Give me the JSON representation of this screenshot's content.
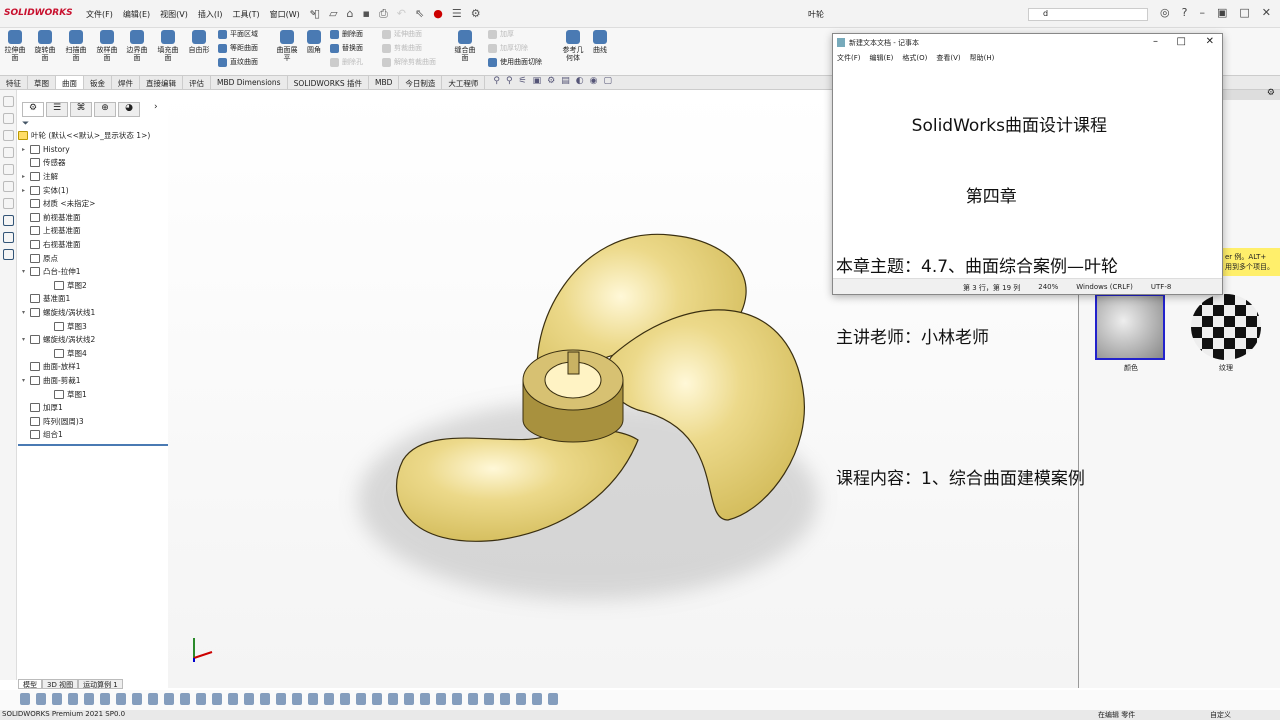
{
  "titlebar": {
    "brand": "SOLIDWORKS",
    "menus": [
      "文件(F)",
      "编辑(E)",
      "视图(V)",
      "插入(I)",
      "工具(T)",
      "窗口(W)"
    ],
    "document": "叶轮",
    "search_value": "d"
  },
  "ribbon": {
    "big": [
      "拉伸曲面",
      "旋转曲面",
      "扫描曲面",
      "放样曲面",
      "边界曲面",
      "填充曲面",
      "自由形"
    ],
    "col1": [
      "平面区域",
      "等距曲面",
      "直纹曲面"
    ],
    "flatten": "曲面展平",
    "fillet": "圆角",
    "col2": [
      "删除面",
      "替换面",
      "删除孔"
    ],
    "col3": [
      "延伸曲面",
      "剪裁曲面",
      "解除剪裁曲面"
    ],
    "knit": "缝合曲面",
    "col4": [
      "加厚",
      "加厚切除",
      "使用曲面切除"
    ],
    "refgeo": "参考几何体",
    "curves": "曲线"
  },
  "tabs": [
    "特征",
    "草图",
    "曲面",
    "钣金",
    "焊件",
    "直接编辑",
    "评估",
    "MBD Dimensions",
    "SOLIDWORKS 插件",
    "MBD",
    "今日制造",
    "大工程师"
  ],
  "tree": {
    "root": "叶轮 (默认<<默认>_显示状态 1>)",
    "items": [
      {
        "label": "History",
        "ex": "▸",
        "ind": 0
      },
      {
        "label": "传感器",
        "ex": "",
        "ind": 0
      },
      {
        "label": "注解",
        "ex": "▸",
        "ind": 0
      },
      {
        "label": "实体(1)",
        "ex": "▸",
        "ind": 0
      },
      {
        "label": "材质 <未指定>",
        "ex": "",
        "ind": 0
      },
      {
        "label": "前视基准面",
        "ex": "",
        "ind": 0
      },
      {
        "label": "上视基准面",
        "ex": "",
        "ind": 0
      },
      {
        "label": "右视基准面",
        "ex": "",
        "ind": 0
      },
      {
        "label": "原点",
        "ex": "",
        "ind": 0
      },
      {
        "label": "凸台-拉伸1",
        "ex": "▾",
        "ind": 0
      },
      {
        "label": "草图2",
        "ex": "",
        "ind": 1
      },
      {
        "label": "基准面1",
        "ex": "",
        "ind": 0
      },
      {
        "label": "螺旋线/涡状线1",
        "ex": "▾",
        "ind": 0
      },
      {
        "label": "草图3",
        "ex": "",
        "ind": 1
      },
      {
        "label": "螺旋线/涡状线2",
        "ex": "▾",
        "ind": 0
      },
      {
        "label": "草图4",
        "ex": "",
        "ind": 1
      },
      {
        "label": "曲面-放样1",
        "ex": "",
        "ind": 0
      },
      {
        "label": "曲面-剪裁1",
        "ex": "▾",
        "ind": 0
      },
      {
        "label": "草图1",
        "ex": "",
        "ind": 1
      },
      {
        "label": "加厚1",
        "ex": "",
        "ind": 0
      },
      {
        "label": "阵列(圆周)3",
        "ex": "",
        "ind": 0
      },
      {
        "label": "组合1",
        "ex": "",
        "ind": 0
      }
    ]
  },
  "notepad": {
    "title": "新建文本文档 - 记事本",
    "menus": [
      "文件(F)",
      "编辑(E)",
      "格式(O)",
      "查看(V)",
      "帮助(H)"
    ],
    "lines": [
      "              SolidWorks曲面设计课程",
      "                        第四章",
      "本章主题：4.7、曲面综合案例—叶轮",
      "主讲老师：小林老师",
      "",
      "课程内容：1、综合曲面建模案例"
    ],
    "status": [
      "第 3 行，第 19 列",
      "240%",
      "Windows (CRLF)",
      "UTF-8"
    ]
  },
  "rpane": {
    "tip": [
      "er 例。ALT+",
      "用到多个项目。"
    ],
    "swatches": [
      "颜色",
      "纹理"
    ]
  },
  "bottom_tabs": [
    "模型",
    "3D 视图",
    "运动算例 1"
  ],
  "status": {
    "left": "SOLIDWORKS Premium 2021 SP0.0",
    "editing": "在编辑 零件",
    "custom": "自定义"
  },
  "colors": {
    "blade": "#e2cf73",
    "edge": "#3a2f10"
  }
}
